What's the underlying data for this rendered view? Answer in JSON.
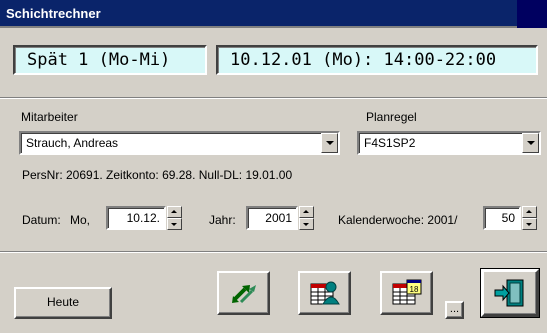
{
  "window": {
    "title": "Schichtrechner"
  },
  "shift": {
    "name": "Spät 1 (Mo-Mi)",
    "datetime": "10.12.01 (Mo): 14:00-22:00"
  },
  "employee": {
    "label": "Mitarbeiter",
    "value": "Strauch, Andreas"
  },
  "rule": {
    "label": "Planregel",
    "value": "F4S1SP2"
  },
  "info": "PersNr: 20691. Zeitkonto: 69.28. Null-DL: 19.01.00",
  "date": {
    "label": "Datum:",
    "weekday": "Mo,",
    "value": "10.12.",
    "year_label": "Jahr:",
    "year_value": "2001",
    "week_label": "Kalenderwoche: 2001/",
    "week_value": "50"
  },
  "buttons": {
    "today": "Heute",
    "more": "..."
  },
  "icons": {
    "swap": "swap-arrows-icon",
    "employee_table": "employee-table-icon",
    "calendar_table": "calendar-table-icon",
    "exit": "exit-door-icon"
  },
  "colors": {
    "title_bg": "#0a246a",
    "banner_bg": "#d8f8f8",
    "face": "#d4d0c8"
  }
}
